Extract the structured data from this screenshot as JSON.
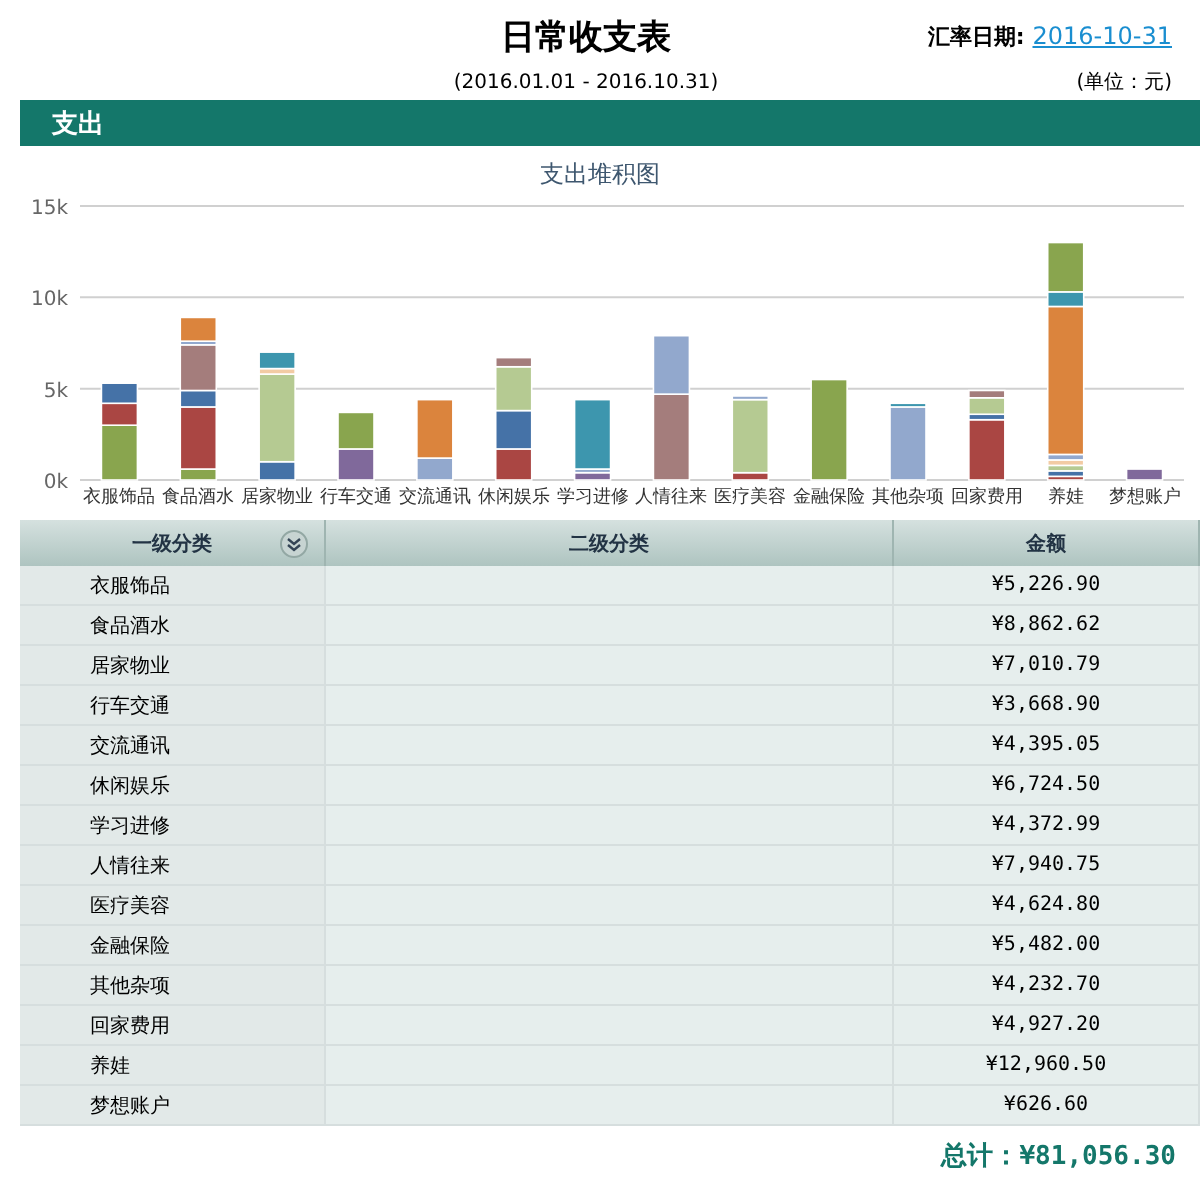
{
  "report": {
    "title": "日常收支表",
    "rate_label": "汇率日期:",
    "rate_date": "2016-10-31",
    "period": "(2016.01.01 - 2016.10.31)",
    "unit": "(单位：元)"
  },
  "section": {
    "title": "支出"
  },
  "chart": {
    "chart_data": {
      "type": "bar",
      "stacked": true,
      "title": "支出堆积图",
      "categories": [
        "衣服饰品",
        "食品酒水",
        "居家物业",
        "行车交通",
        "交流通讯",
        "休闲娱乐",
        "学习进修",
        "人情往来",
        "医疗美容",
        "金融保险",
        "其他杂项",
        "回家费用",
        "养娃",
        "梦想账户"
      ],
      "ylim": [
        0,
        15000
      ],
      "yticks": [
        {
          "value": 0,
          "label": "0k"
        },
        {
          "value": 5000,
          "label": "5k"
        },
        {
          "value": 10000,
          "label": "10k"
        },
        {
          "value": 15000,
          "label": "15k"
        }
      ],
      "series": [
        {
          "color": "#80699b",
          "values": [
            null,
            null,
            null,
            1700,
            null,
            null,
            400,
            null,
            null,
            null,
            null,
            null,
            null,
            600
          ]
        },
        {
          "color": "#89a54e",
          "values": [
            3000,
            600,
            null,
            2000,
            null,
            null,
            null,
            null,
            null,
            5500,
            null,
            null,
            null,
            null
          ]
        },
        {
          "color": "#aa4643",
          "values": [
            1200,
            3400,
            null,
            null,
            null,
            1700,
            null,
            null,
            400,
            null,
            null,
            3300,
            200,
            null
          ]
        },
        {
          "color": "#4572a7",
          "values": [
            1100,
            900,
            1000,
            null,
            null,
            2100,
            null,
            null,
            null,
            null,
            null,
            300,
            300,
            null
          ]
        },
        {
          "color": "#b5ca92",
          "values": [
            null,
            null,
            4800,
            null,
            null,
            2400,
            null,
            null,
            4000,
            null,
            null,
            900,
            300,
            null
          ]
        },
        {
          "color": "#f2cba4",
          "values": [
            null,
            null,
            300,
            null,
            null,
            null,
            null,
            null,
            null,
            null,
            null,
            null,
            300,
            null
          ]
        },
        {
          "color": "#a47d7c",
          "values": [
            null,
            2500,
            null,
            null,
            null,
            500,
            null,
            4700,
            null,
            null,
            null,
            400,
            null,
            null
          ]
        },
        {
          "color": "#92a8cd",
          "values": [
            null,
            200,
            null,
            null,
            1200,
            null,
            200,
            3200,
            200,
            null,
            4000,
            null,
            300,
            null
          ]
        },
        {
          "color": "#db843d",
          "values": [
            null,
            1300,
            null,
            null,
            3200,
            null,
            null,
            null,
            null,
            null,
            null,
            null,
            8100,
            null
          ]
        },
        {
          "color": "#3d96ae",
          "values": [
            null,
            null,
            900,
            null,
            null,
            null,
            3800,
            null,
            null,
            null,
            200,
            null,
            800,
            null
          ]
        },
        {
          "color": "#89a54e",
          "values": [
            null,
            null,
            null,
            null,
            null,
            null,
            null,
            null,
            null,
            null,
            null,
            null,
            2700,
            null
          ]
        }
      ]
    }
  },
  "table": {
    "columns": [
      "一级分类",
      "二级分类",
      "金额"
    ],
    "rows": [
      {
        "category": "衣服饰品",
        "amount": "¥5,226.90"
      },
      {
        "category": "食品酒水",
        "amount": "¥8,862.62"
      },
      {
        "category": "居家物业",
        "amount": "¥7,010.79"
      },
      {
        "category": "行车交通",
        "amount": "¥3,668.90"
      },
      {
        "category": "交流通讯",
        "amount": "¥4,395.05"
      },
      {
        "category": "休闲娱乐",
        "amount": "¥6,724.50"
      },
      {
        "category": "学习进修",
        "amount": "¥4,372.99"
      },
      {
        "category": "人情往来",
        "amount": "¥7,940.75"
      },
      {
        "category": "医疗美容",
        "amount": "¥4,624.80"
      },
      {
        "category": "金融保险",
        "amount": "¥5,482.00"
      },
      {
        "category": "其他杂项",
        "amount": "¥4,232.70"
      },
      {
        "category": "回家费用",
        "amount": "¥4,927.20"
      },
      {
        "category": "养娃",
        "amount": "¥12,960.50"
      },
      {
        "category": "梦想账户",
        "amount": "¥626.60"
      }
    ]
  },
  "total": "总计：¥81,056.30"
}
